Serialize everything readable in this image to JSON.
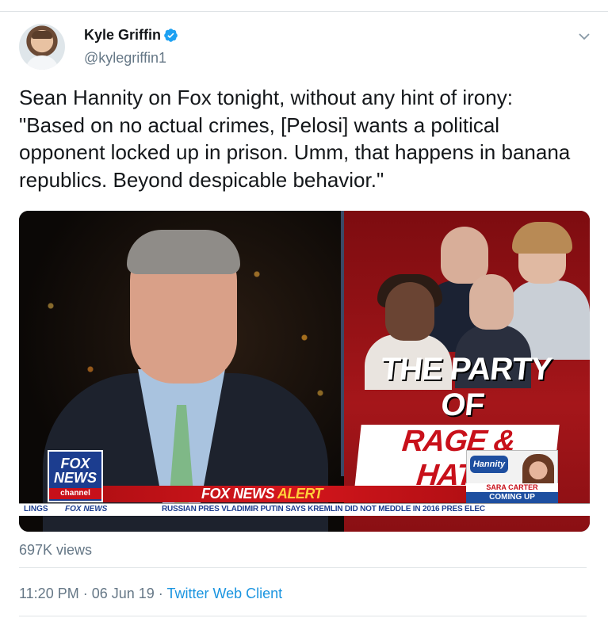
{
  "author": {
    "name": "Kyle Griffin",
    "handle": "@kylegriffin1",
    "verified": true
  },
  "tweet": {
    "text": "Sean Hannity on Fox tonight, without any hint of irony:\n\"Based on no actual crimes, [Pelosi] wants a political opponent locked up in prison. Umm, that happens in banana republics. Beyond despicable behavior.\""
  },
  "media": {
    "headline_line1": "THE PARTY OF",
    "headline_line2": "RAGE & HATE",
    "show_logo": "Hannity",
    "guest_name": "SARA CARTER",
    "coming_up": "COMING UP",
    "network_fox": "FOX",
    "network_news": "NEWS",
    "network_channel": "channel",
    "alert_prefix": "FOX NEWS ",
    "alert_word": "ALERT",
    "ticker_left": "LINGS",
    "ticker_brand": "FOX NEWS",
    "ticker_text": "RUSSIAN PRES VLADIMIR PUTIN SAYS KREMLIN DID NOT MEDDLE IN 2016 PRES ELEC"
  },
  "stats": {
    "views": "697K views"
  },
  "meta": {
    "time": "11:20 PM",
    "separator": " · ",
    "date": "06 Jun 19",
    "client": "Twitter Web Client"
  },
  "icons": {
    "verified": "verified-badge-icon",
    "menu": "chevron-down-icon"
  },
  "colors": {
    "text_primary": "#14171a",
    "text_secondary": "#657786",
    "link": "#1b95e0",
    "verified": "#1da1f2",
    "fox_red": "#c8101a",
    "fox_blue": "#1c3d8f"
  }
}
